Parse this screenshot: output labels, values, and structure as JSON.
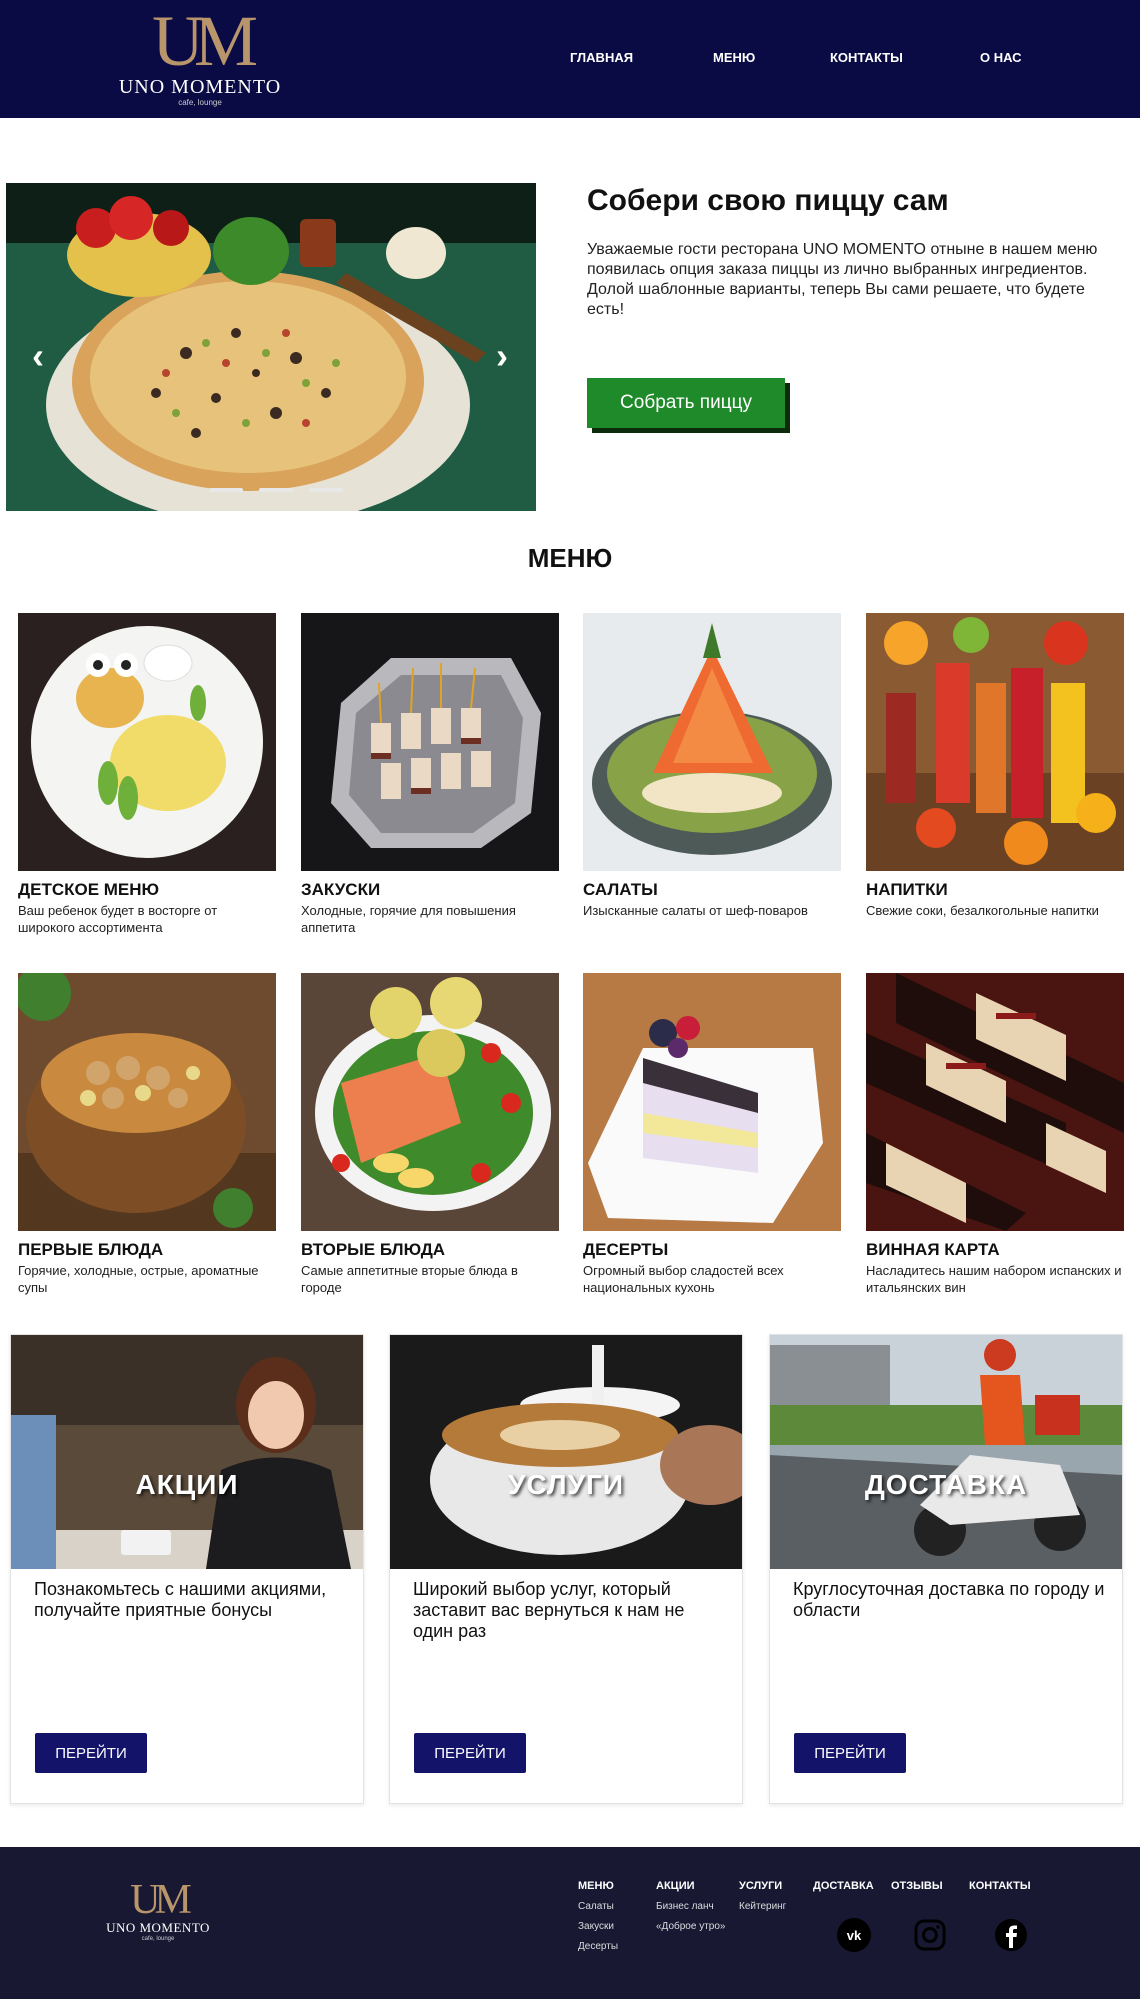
{
  "brand": {
    "mark": "UM",
    "name": "UNO MOMENTO",
    "tagline": "cafe, lounge"
  },
  "nav": [
    "ГЛАВНАЯ",
    "МЕНЮ",
    "КОНТАКТЫ",
    "О НАС"
  ],
  "hero": {
    "title": "Собери свою пиццу сам",
    "text": "Уважаемые гости ресторана UNO MOMENTO отныне в нашем меню появилась опция заказа пиццы из лично выбранных ингредиентов.\n Долой шаблонные варианты, теперь Вы сами решаете, что будете есть!",
    "button": "Собрать пиццу",
    "slides": 3,
    "active_slide": 1
  },
  "menu": {
    "title": "МЕНЮ",
    "items": [
      {
        "name": "Детское меню",
        "desc": "Ваш ребенок будет в восторге от широкого ассортимента"
      },
      {
        "name": "Закуски",
        "desc": "Холодные, горячие для повышения аппетита"
      },
      {
        "name": "Салаты",
        "desc": "Изысканные салаты от шеф-поваров"
      },
      {
        "name": "Напитки",
        "desc": "Свежие соки, безалкогольные напитки"
      },
      {
        "name": "Первые блюда",
        "desc": "Горячие, холодные, острые, ароматные супы"
      },
      {
        "name": "Вторые блюда",
        "desc": "Самые аппетитные вторые блюда в городе"
      },
      {
        "name": "Десерты",
        "desc": "Огромный выбор сладостей всех национальных кухонь"
      },
      {
        "name": "Винная карта",
        "desc": "Насладитесь нашим набором испанских и итальянских вин"
      }
    ]
  },
  "promos": [
    {
      "label": "АКЦИИ",
      "text": "Познакомьтесь с нашими акциями, получайте приятные бонусы",
      "button": "ПЕРЕЙТИ"
    },
    {
      "label": "УСЛУГИ",
      "text": "Широкий выбор услуг, который заставит вас вернуться к нам не один раз",
      "button": "ПЕРЕЙТИ"
    },
    {
      "label": "ДОСТАВКА",
      "text": "Круглосуточная доставка по городу и области",
      "button": "ПЕРЕЙТИ"
    }
  ],
  "footer": {
    "columns": [
      {
        "head": "МЕНЮ",
        "items": [
          "Салаты",
          "Закуски",
          "Десерты"
        ]
      },
      {
        "head": "АКЦИИ",
        "items": [
          "Бизнес ланч",
          "«Доброе утро»"
        ]
      },
      {
        "head": "УСЛУГИ",
        "items": [
          "Кейтеринг"
        ]
      },
      {
        "head": "ДОСТАВКА",
        "items": []
      },
      {
        "head": "ОТЗЫВЫ",
        "items": []
      },
      {
        "head": "КОНТАКТЫ",
        "items": []
      }
    ],
    "social": [
      "vk-icon",
      "instagram-icon",
      "facebook-icon"
    ]
  },
  "colors": {
    "header_bg": "#0a0a45",
    "accent_gold": "#b8956a",
    "cta_green": "#1f8a2a",
    "button_navy": "#13136a",
    "footer_bg": "#181833"
  }
}
